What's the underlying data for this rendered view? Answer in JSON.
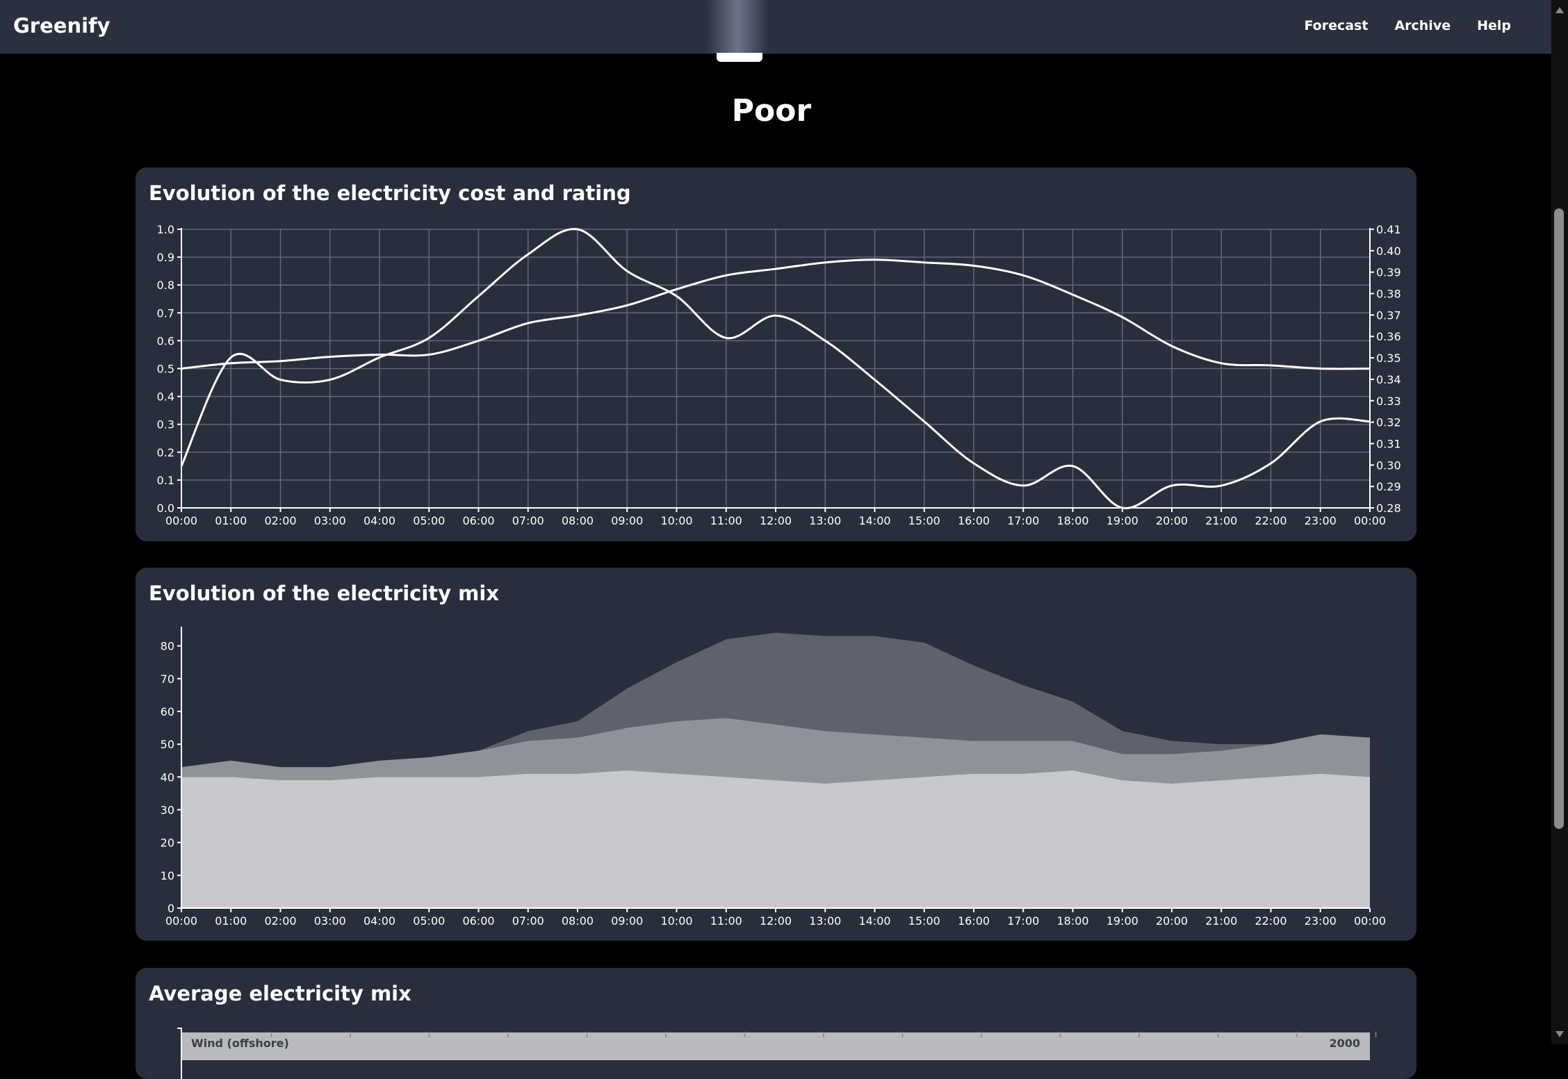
{
  "app": {
    "brand": "Greenify",
    "nav": [
      "Forecast",
      "Archive",
      "Help"
    ]
  },
  "rating": "Poor",
  "colors": {
    "background": "#000000",
    "card": "#282e3b",
    "line": "#ffffff",
    "area_light": "#c8c9cd",
    "area_mid": "#8f9298",
    "area_dark": "#5e626d"
  },
  "cost_chart": {
    "title": "Evolution of the electricity cost and rating",
    "chart_data": {
      "type": "line",
      "x": [
        "00:00",
        "01:00",
        "02:00",
        "03:00",
        "04:00",
        "05:00",
        "06:00",
        "07:00",
        "08:00",
        "09:00",
        "10:00",
        "11:00",
        "12:00",
        "13:00",
        "14:00",
        "15:00",
        "16:00",
        "17:00",
        "18:00",
        "19:00",
        "20:00",
        "21:00",
        "22:00",
        "23:00",
        "00:00"
      ],
      "y_left_ticks": [
        "0.0",
        "0.1",
        "0.2",
        "0.3",
        "0.4",
        "0.5",
        "0.6",
        "0.7",
        "0.8",
        "0.9",
        "1.0"
      ],
      "y_left_range": [
        0,
        1
      ],
      "y_right_ticks": [
        "0.28",
        "0.29",
        "0.30",
        "0.31",
        "0.32",
        "0.33",
        "0.34",
        "0.35",
        "0.36",
        "0.37",
        "0.38",
        "0.39",
        "0.40",
        "0.41"
      ],
      "y_right_range": [
        0.28,
        0.41
      ],
      "grid": true,
      "series": [
        {
          "axis": "right",
          "values": [
            0.345,
            0.3475,
            0.3485,
            0.3505,
            0.3515,
            0.3515,
            0.358,
            0.3662,
            0.3698,
            0.3745,
            0.382,
            0.3885,
            0.3915,
            0.3945,
            0.3958,
            0.3945,
            0.393,
            0.3885,
            0.3795,
            0.369,
            0.3555,
            0.3475,
            0.3465,
            0.345,
            0.345
          ]
        },
        {
          "axis": "left",
          "values": [
            0.15,
            0.54,
            0.46,
            0.46,
            0.54,
            0.61,
            0.76,
            0.91,
            1.0,
            0.85,
            0.76,
            0.61,
            0.69,
            0.6,
            0.46,
            0.31,
            0.16,
            0.08,
            0.15,
            0.0,
            0.08,
            0.08,
            0.16,
            0.31,
            0.31
          ]
        }
      ]
    }
  },
  "mix_chart": {
    "title": "Evolution of the electricity mix",
    "chart_data": {
      "type": "area",
      "stacked": true,
      "x": [
        "00:00",
        "01:00",
        "02:00",
        "03:00",
        "04:00",
        "05:00",
        "06:00",
        "07:00",
        "08:00",
        "09:00",
        "10:00",
        "11:00",
        "12:00",
        "13:00",
        "14:00",
        "15:00",
        "16:00",
        "17:00",
        "18:00",
        "19:00",
        "20:00",
        "21:00",
        "22:00",
        "23:00",
        "00:00"
      ],
      "y_ticks": [
        "0",
        "10",
        "20",
        "30",
        "40",
        "50",
        "60",
        "70",
        "80"
      ],
      "ylim": [
        0,
        85
      ],
      "series": [
        {
          "color": "#c8c9cd",
          "values": [
            40,
            40,
            39,
            39,
            40,
            40,
            40,
            41,
            41,
            42,
            41,
            40,
            39,
            38,
            39,
            40,
            41,
            41,
            42,
            39,
            38,
            39,
            40,
            41,
            40
          ]
        },
        {
          "color": "#8f9298",
          "values": [
            3,
            5,
            4,
            4,
            5,
            6,
            8,
            10,
            11,
            13,
            16,
            18,
            17,
            16,
            14,
            12,
            10,
            10,
            9,
            8,
            9,
            9,
            10,
            12,
            12
          ]
        },
        {
          "color": "#5e626d",
          "values": [
            0,
            0,
            0,
            0,
            0,
            0,
            0,
            3,
            5,
            12,
            18,
            24,
            28,
            29,
            30,
            29,
            23,
            17,
            12,
            7,
            4,
            2,
            0,
            0,
            0
          ]
        }
      ]
    }
  },
  "avg_chart": {
    "title": "Average electricity mix",
    "visible_label": "Wind (offshore)",
    "visible_value": "2000"
  }
}
